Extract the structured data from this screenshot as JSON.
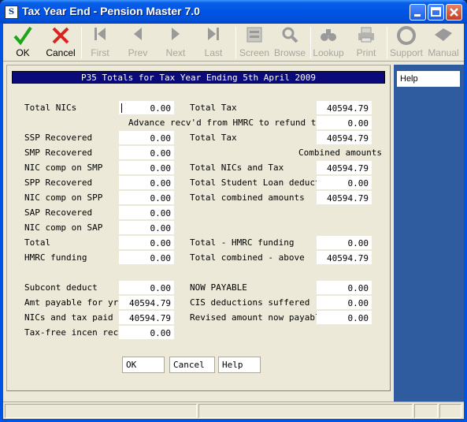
{
  "window": {
    "title": "Tax Year End - Pension Master 7.0",
    "icon": "app-icon"
  },
  "toolbar": {
    "ok": "OK",
    "cancel": "Cancel",
    "first": "First",
    "prev": "Prev",
    "next": "Next",
    "last": "Last",
    "screen": "Screen",
    "browse": "Browse",
    "lookup": "Lookup",
    "print": "Print",
    "support": "Support",
    "manual": "Manual"
  },
  "form": {
    "header": "P35 Totals for Tax Year Ending 5th April 2009",
    "left": [
      {
        "label": "Total NICs",
        "value": "0.00"
      },
      {
        "label": "SSP Recovered",
        "value": "0.00"
      },
      {
        "label": "SMP Recovered",
        "value": "0.00"
      },
      {
        "label": "NIC comp on SMP",
        "value": "0.00"
      },
      {
        "label": "SPP Recovered",
        "value": "0.00"
      },
      {
        "label": "NIC comp on SPP",
        "value": "0.00"
      },
      {
        "label": "SAP Recovered",
        "value": "0.00"
      },
      {
        "label": "NIC comp on SAP",
        "value": "0.00"
      },
      {
        "label": "Total",
        "value": "0.00"
      },
      {
        "label": "HMRC funding",
        "value": "0.00"
      },
      {
        "label": "Subcont deduct",
        "value": "0.00"
      },
      {
        "label": "Amt payable for yr",
        "value": "40594.79"
      },
      {
        "label": "NICs and tax paid",
        "value": "40594.79"
      },
      {
        "label": "Tax-free incen rec",
        "value": "0.00"
      }
    ],
    "right": [
      {
        "label": "Total Tax",
        "value": "40594.79"
      },
      {
        "label": "Advance recv'd from HMRC to refund tax",
        "value": "0.00"
      },
      {
        "label": "Total Tax",
        "value": "40594.79"
      },
      {
        "label": "Combined amounts"
      },
      {
        "label": "Total NICs and Tax",
        "value": "40594.79"
      },
      {
        "label": "Total Student Loan deduct",
        "value": "0.00"
      },
      {
        "label": "Total combined amounts",
        "value": "40594.79"
      },
      {
        "label": "Total - HMRC funding",
        "value": "0.00"
      },
      {
        "label": "Total combined - above",
        "value": "40594.79"
      },
      {
        "label": "NOW PAYABLE",
        "value": "0.00"
      },
      {
        "label": "CIS deductions suffered",
        "value": "0.00"
      },
      {
        "label": "Revised amount now payable",
        "value": "0.00"
      }
    ],
    "buttons": {
      "ok": "OK",
      "cancel": "Cancel",
      "help": "Help"
    }
  },
  "side": {
    "help": "Help"
  }
}
